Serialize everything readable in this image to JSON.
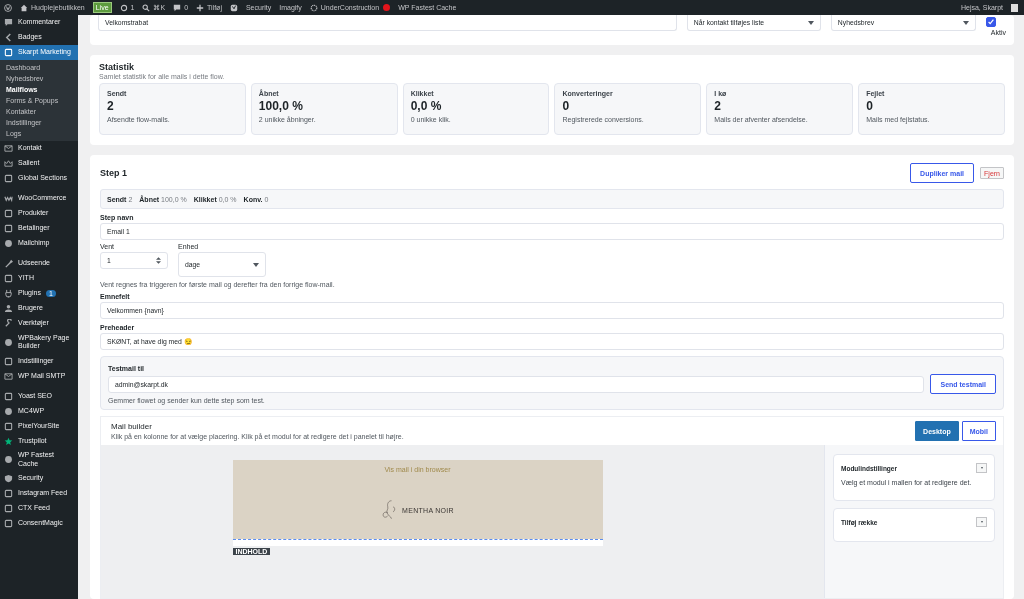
{
  "admin_bar": {
    "site": "Hudplejebutikken",
    "live_badge": "Live",
    "updates": "1",
    "search_shortcut": "⌘K",
    "comments": "0",
    "add_new": "Tilføj",
    "links": [
      "Security",
      "Imagify"
    ],
    "under_construction": {
      "label": "UnderConstruction",
      "color": "#e3141b"
    },
    "cache": "WP Fastest Cache",
    "greeting": "Hejsa, Skarpt"
  },
  "sidebar": {
    "groups": [
      [
        {
          "label": "Kommentarer",
          "selected": false
        },
        {
          "label": "Badges",
          "selected": false
        },
        {
          "label": "Skarpt Marketing",
          "selected": true,
          "children": [
            {
              "label": "Dashboard",
              "selected": false
            },
            {
              "label": "Nyhedsbrev",
              "selected": false
            },
            {
              "label": "Mailflows",
              "selected": true
            },
            {
              "label": "Forms & Popups",
              "selected": false
            },
            {
              "label": "Kontakter",
              "selected": false
            },
            {
              "label": "Indstillinger",
              "selected": false
            },
            {
              "label": "Logs",
              "selected": false
            }
          ]
        },
        {
          "label": "Kontakt",
          "selected": false
        },
        {
          "label": "Salient",
          "selected": false
        },
        {
          "label": "Global Sections",
          "selected": false
        }
      ],
      [
        {
          "label": "WooCommerce",
          "selected": false
        },
        {
          "label": "Produkter",
          "selected": false
        },
        {
          "label": "Betalinger",
          "selected": false
        },
        {
          "label": "Mailchimp",
          "selected": false
        }
      ],
      [
        {
          "label": "Udseende",
          "selected": false
        },
        {
          "label": "YITH",
          "selected": false
        },
        {
          "label": "Plugins",
          "selected": false,
          "badge": "1"
        },
        {
          "label": "Brugere",
          "selected": false
        },
        {
          "label": "Værktøjer",
          "selected": false
        },
        {
          "label": "WPBakery Page Builder",
          "selected": false
        },
        {
          "label": "Indstillinger",
          "selected": false
        },
        {
          "label": "WP Mail SMTP",
          "selected": false
        }
      ],
      [
        {
          "label": "Yoast SEO",
          "selected": false
        },
        {
          "label": "MC4WP",
          "selected": false
        },
        {
          "label": "PixelYourSite",
          "selected": false
        },
        {
          "label": "Trustpilot",
          "selected": false
        },
        {
          "label": "WP Fastest Cache",
          "selected": false
        },
        {
          "label": "Security",
          "selected": false
        },
        {
          "label": "Instagram Feed",
          "selected": false
        },
        {
          "label": "CTX Feed",
          "selected": false
        },
        {
          "label": "ConsentMagic",
          "selected": false
        }
      ]
    ]
  },
  "flow": {
    "name": "Velkomstrabat",
    "trigger": "Når kontakt tilføjes liste",
    "list": "Nyhedsbrev",
    "active": {
      "label": "Aktiv",
      "checked": true
    }
  },
  "statistics": {
    "title": "Statistik",
    "subtitle": "Samlet statistik for alle mails i dette flow.",
    "cards": [
      {
        "label": "Sendt",
        "value": "2",
        "note": "Afsendte flow-mails."
      },
      {
        "label": "Åbnet",
        "value": "100,0 %",
        "note": "2 unikke åbninger."
      },
      {
        "label": "Klikket",
        "value": "0,0 %",
        "note": "0 unikke klik."
      },
      {
        "label": "Konverteringer",
        "value": "0",
        "note": "Registrerede conversions."
      },
      {
        "label": "I kø",
        "value": "2",
        "note": "Mails der afventer afsendelse."
      },
      {
        "label": "Fejlet",
        "value": "0",
        "note": "Mails med fejlstatus."
      }
    ]
  },
  "step": {
    "title": "Step 1",
    "buttons": {
      "duplicate": "Dupliker mail",
      "remove": "Fjern"
    },
    "summary": [
      {
        "label": "Sendt",
        "value": "2"
      },
      {
        "label": "Åbnet",
        "value": "100,0 %"
      },
      {
        "label": "Klikket",
        "value": "0,0 %"
      },
      {
        "label": "Konv.",
        "value": "0"
      }
    ],
    "name": {
      "label": "Step navn",
      "value": "Email 1"
    },
    "wait": {
      "label": "Vent",
      "value": "1"
    },
    "unit": {
      "label": "Enhed",
      "value": "dage"
    },
    "wait_hint": "Vent regnes fra triggeren for første mail og derefter fra den forrige flow-mail.",
    "subject": {
      "label": "Emnefelt",
      "value": "Velkommen {navn}"
    },
    "preheader": {
      "label": "Preheader",
      "value": "SKØNT, at have dig med 😏"
    },
    "testmail": {
      "label": "Testmail til",
      "value": "admin@skarpt.dk",
      "button": "Send testmail",
      "hint": "Gemmer flowet og sender kun dette step som test."
    }
  },
  "mail_builder": {
    "title": "Mail builder",
    "subtitle": "Klik på en kolonne for at vælge placering. Klik på et modul for at redigere det i panelet til højre.",
    "views": [
      {
        "label": "Desktop",
        "selected": true
      },
      {
        "label": "Mobil",
        "selected": false
      }
    ],
    "preview": {
      "browser_link": "Vis mail i din browser",
      "brand": "MENTHA NOIR",
      "section_tag": "INDHOLD"
    },
    "panels": [
      {
        "title": "Modulindstillinger",
        "toggle": "▾",
        "text": "Vælg et modul i mallen for at redigere det."
      },
      {
        "title": "Tilføj række",
        "toggle": "▾"
      }
    ]
  }
}
